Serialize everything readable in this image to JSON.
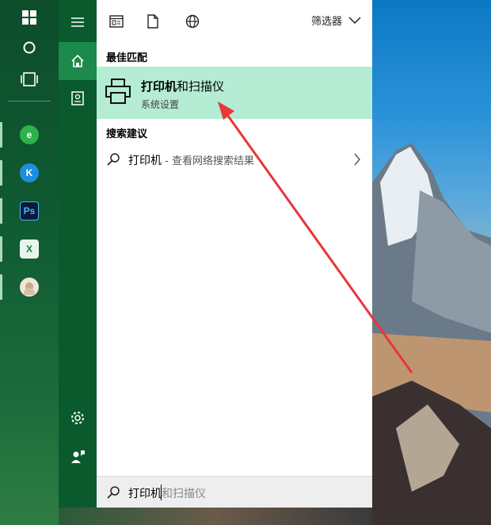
{
  "taskbar": {
    "icons": [
      "windows-logo-icon",
      "cortana-circle-icon",
      "task-view-icon"
    ],
    "apps": [
      {
        "name": "360-browser-icon",
        "glyph": "e",
        "color": "#2db34a"
      },
      {
        "name": "kugou-music-icon",
        "glyph": "K",
        "color": "#1e8fe0"
      },
      {
        "name": "photoshop-icon",
        "glyph": "Ps",
        "color": "#0a1a3a"
      },
      {
        "name": "excel-icon",
        "glyph": "X",
        "color": "#2a8a4a"
      },
      {
        "name": "avatar-app-icon",
        "glyph": "",
        "color": "#d9c9b9"
      }
    ]
  },
  "rail": {
    "items": [
      "hamburger-menu-icon",
      "home-icon",
      "notebook-icon"
    ],
    "bottom": [
      "settings-gear-icon",
      "user-feedback-icon"
    ]
  },
  "toolbar": {
    "filter_label": "筛选器",
    "tools": [
      "apps-filter-icon",
      "documents-filter-icon",
      "web-filter-icon"
    ]
  },
  "best_match": {
    "section_title": "最佳匹配",
    "title_bold": "打印机",
    "title_rest": "和扫描仪",
    "subtitle": "系统设置"
  },
  "suggestions": {
    "section_title": "搜索建议",
    "items": [
      {
        "query": "打印机",
        "suffix": " - 查看网络搜索结果"
      }
    ]
  },
  "search": {
    "typed": "打印机",
    "ghost": "和扫描仪"
  },
  "colors": {
    "accent": "#0a5a2e",
    "highlight": "#b4ecd4",
    "annotation_arrow": "#e8363a"
  }
}
